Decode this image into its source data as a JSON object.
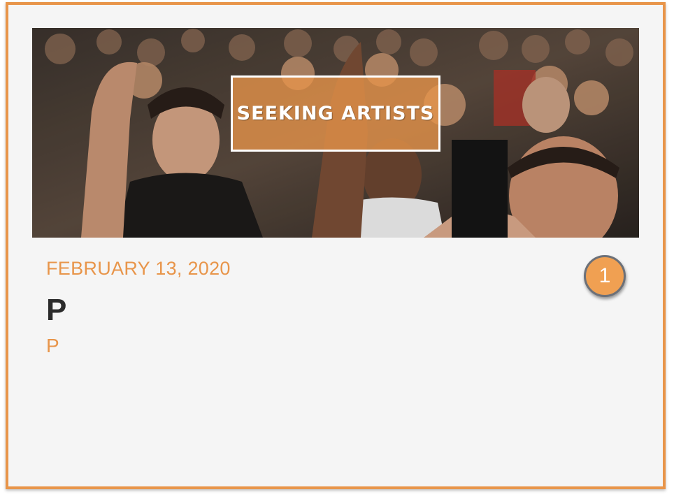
{
  "card": {
    "banner_label": "SEEKING ARTISTS",
    "date": "FEBRUARY 13, 2020",
    "title": "P",
    "subtitle": "P",
    "badge_count": "1"
  },
  "colors": {
    "accent": "#e8954a",
    "card_background": "#f5f5f5",
    "title_text": "#2b2b2b",
    "badge_border": "#6c7078"
  }
}
